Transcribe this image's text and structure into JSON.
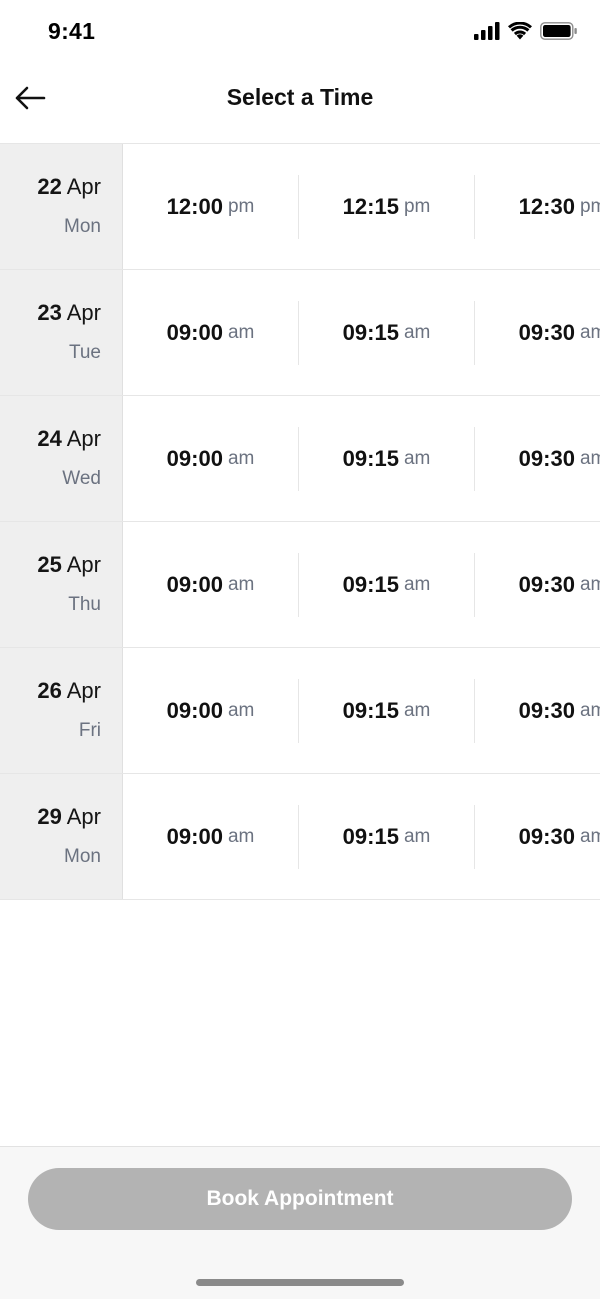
{
  "status_bar": {
    "time": "9:41",
    "icons": [
      "cellular-signal-icon",
      "wifi-icon",
      "battery-icon"
    ]
  },
  "header": {
    "back_icon": "arrow-left-icon",
    "title": "Select a Time"
  },
  "days": [
    {
      "day": "22",
      "month": "Apr",
      "weekday": "Mon",
      "slots": [
        {
          "time": "12:00",
          "period": "pm"
        },
        {
          "time": "12:15",
          "period": "pm"
        },
        {
          "time": "12:30",
          "period": "pm"
        }
      ]
    },
    {
      "day": "23",
      "month": "Apr",
      "weekday": "Tue",
      "slots": [
        {
          "time": "09:00",
          "period": "am"
        },
        {
          "time": "09:15",
          "period": "am"
        },
        {
          "time": "09:30",
          "period": "am"
        }
      ]
    },
    {
      "day": "24",
      "month": "Apr",
      "weekday": "Wed",
      "slots": [
        {
          "time": "09:00",
          "period": "am"
        },
        {
          "time": "09:15",
          "period": "am"
        },
        {
          "time": "09:30",
          "period": "am"
        }
      ]
    },
    {
      "day": "25",
      "month": "Apr",
      "weekday": "Thu",
      "slots": [
        {
          "time": "09:00",
          "period": "am"
        },
        {
          "time": "09:15",
          "period": "am"
        },
        {
          "time": "09:30",
          "period": "am"
        }
      ]
    },
    {
      "day": "26",
      "month": "Apr",
      "weekday": "Fri",
      "slots": [
        {
          "time": "09:00",
          "period": "am"
        },
        {
          "time": "09:15",
          "period": "am"
        },
        {
          "time": "09:30",
          "period": "am"
        }
      ]
    },
    {
      "day": "29",
      "month": "Apr",
      "weekday": "Mon",
      "slots": [
        {
          "time": "09:00",
          "period": "am"
        },
        {
          "time": "09:15",
          "period": "am"
        },
        {
          "time": "09:30",
          "period": "am"
        }
      ]
    }
  ],
  "footer": {
    "book_label": "Book Appointment",
    "book_color": "#b3b3b3"
  }
}
